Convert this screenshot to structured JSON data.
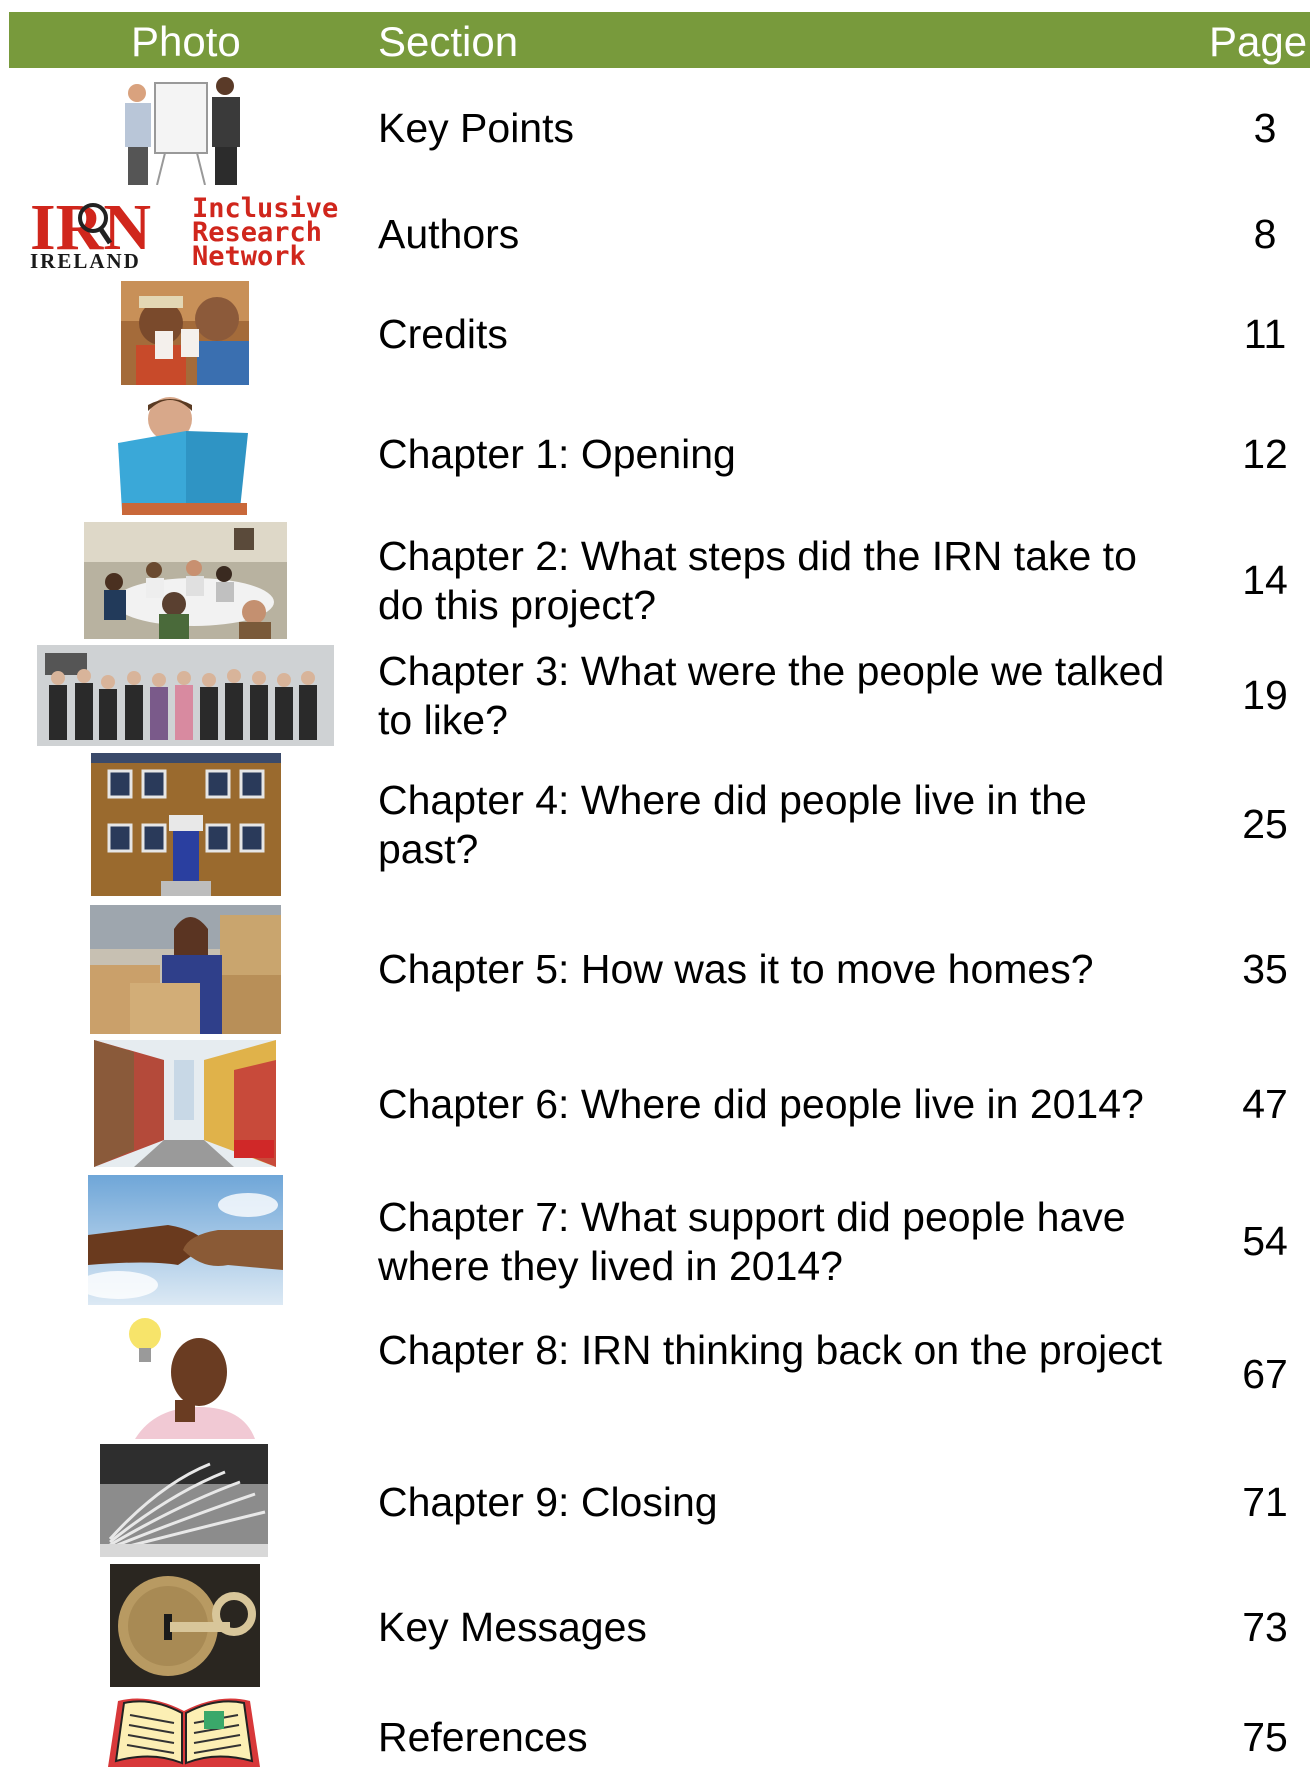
{
  "header": {
    "photo": "Photo",
    "section": "Section",
    "page": "Page"
  },
  "logo": {
    "irn": "IRN",
    "ireland": "IRELAND",
    "line1": "Inclusive",
    "line2": "Research",
    "line3": "Network"
  },
  "rows": [
    {
      "section": "Key Points",
      "page": "3",
      "icon": "presentation-photo"
    },
    {
      "section": "Authors",
      "page": "8",
      "icon": "irn-logo"
    },
    {
      "section": "Credits",
      "page": "11",
      "icon": "cheers-photo"
    },
    {
      "section": "Chapter 1: Opening",
      "page": "12",
      "icon": "reading-photo"
    },
    {
      "section": "Chapter 2: What steps did the IRN take to do this project?",
      "page": "14",
      "icon": "meeting-photo"
    },
    {
      "section": "Chapter 3: What were the people we talked to like?",
      "page": "19",
      "icon": "group-photo"
    },
    {
      "section": "Chapter 4: Where did people live in the past?",
      "page": "25",
      "icon": "house-photo"
    },
    {
      "section": "Chapter 5: How was it to move homes?",
      "page": "35",
      "icon": "moving-boxes-photo"
    },
    {
      "section": "Chapter 6: Where did people live in 2014?",
      "page": "47",
      "icon": "street-photo"
    },
    {
      "section": "Chapter 7: What support did people have where they lived in 2014?",
      "page": "54",
      "icon": "handshake-photo"
    },
    {
      "section": "Chapter 8: IRN thinking back on the project",
      "page": "67",
      "icon": "thinking-photo"
    },
    {
      "section": "Chapter 9: Closing",
      "page": "71",
      "icon": "book-pages-photo"
    },
    {
      "section": "Key Messages",
      "page": "73",
      "icon": "key-lock-photo"
    },
    {
      "section": "References",
      "page": "75",
      "icon": "open-book-icon"
    }
  ]
}
